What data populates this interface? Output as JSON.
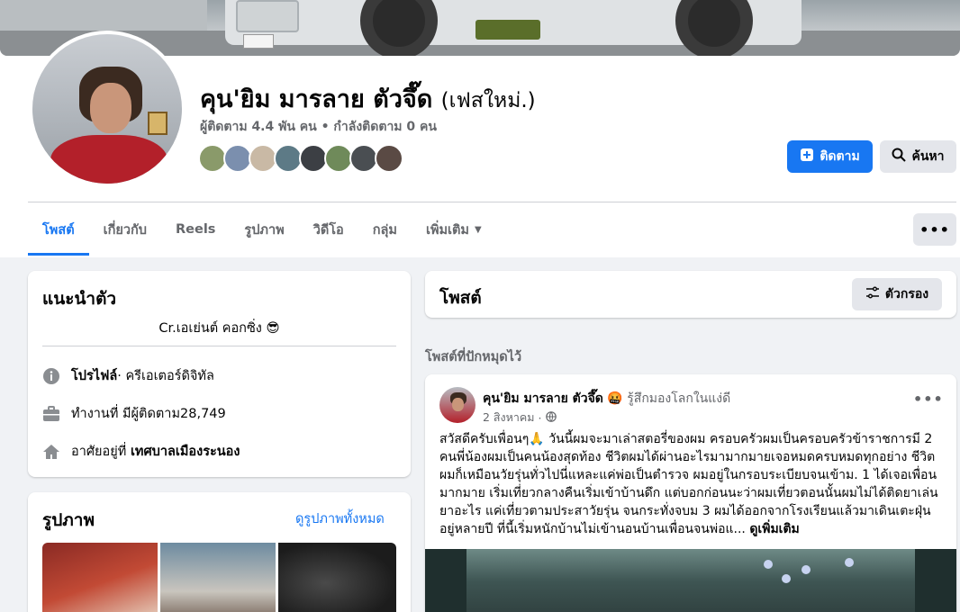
{
  "profile": {
    "name": "คุน'ยิม มารลาย ตัวจึ๊ด",
    "alt_name": "(เฟสใหม่.)",
    "follow_stats": "ผู้ติดตาม 4.4 พัน คน • กำลังติดตาม 0 คน"
  },
  "actions": {
    "follow_label": "ติดตาม",
    "search_label": "ค้นหา",
    "more_label": "•••"
  },
  "tabs": [
    {
      "label": "โพสต์",
      "active": true
    },
    {
      "label": "เกี่ยวกับ"
    },
    {
      "label": "Reels"
    },
    {
      "label": "รูปภาพ"
    },
    {
      "label": "วิดีโอ"
    },
    {
      "label": "กลุ่ม"
    },
    {
      "label": "เพิ่มเติม"
    }
  ],
  "intro": {
    "title": "แนะนำตัว",
    "bio": "Cr.เอเย่นต์ คอกซิ่ง 😎",
    "profile_label": "โปรไฟล์",
    "profile_value": " · ครีเอเตอร์ดิจิทัล",
    "work": "ทำงานที่ มีผู้ติดตาม28,749",
    "lives_prefix": "อาศัยอยู่ที่ ",
    "lives_place": "เทศบาลเมืองระนอง"
  },
  "photos": {
    "title": "รูปภาพ",
    "see_all": "ดูรูปภาพทั้งหมด"
  },
  "posts": {
    "title": "โพสต์",
    "filter_label": "ตัวกรอง",
    "pinned_label": "โพสต์ที่ปักหมุดไว้"
  },
  "post": {
    "author": "คุน'ยิม มารลาย ตัวจึ๊ด",
    "feeling_emoji": "🤬",
    "feeling": "รู้สึกมองโลกในแง่ดี",
    "date": "2 สิงหาคม",
    "menu": "•••",
    "text": "สวัสดีครับเพื่อนๆ🙏 วันนี้ผมจะมาเล่าสตอรี่ของผม ครอบครัวผมเป็นครอบครัวข้าราชการมี 2 คนพี่น้องผมเป็นคนน้องสุดท้อง ชีวิตผมได้ผ่านอะไรมามากมายเจอหมดครบหมดทุกอย่าง ชีวิตผมก็เหมือนวัยรุ่นทั่วไปนี่แหละแค่พ่อเป็นตำรวจ ผมอยู่ในกรอบระเบียบจนเข้าม. 1 ได้เจอเพื่อนมากมาย เริ่มเที่ยวกลางคืนเริ่มเข้าบ้านดึก แต่บอกก่อนนะว่าผมเที่ยวตอนนั้นผมไม่ได้ติดยาเล่นยาอะไร แค่เที่ยวตามประสาวัยรุ่น จนกระทั่งจบม 3 ผมได้ออกจากโรงเรียนแล้วมาเดินเตะฝุ่นอยู่หลายปี ที่นี้เริ่มหนักบ้านไม่เข้านอนบ้านเพื่อนจนพ่อแ...",
    "see_more": "ดูเพิ่มเติม"
  },
  "colors": {
    "accent": "#1877f2",
    "background": "#f0f2f5",
    "secondary_text": "#65676b"
  }
}
